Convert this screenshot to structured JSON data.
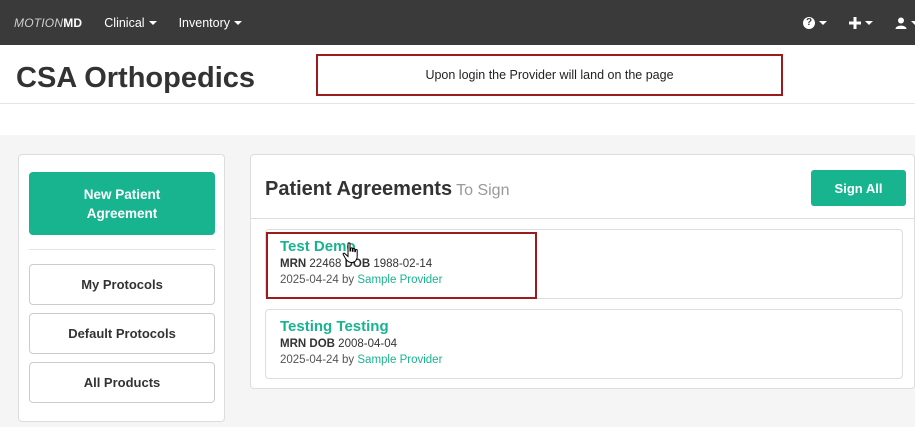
{
  "navbar": {
    "brand_part1": "MOTION",
    "brand_part2": "MD",
    "menus": [
      {
        "label": "Clinical"
      },
      {
        "label": "Inventory"
      }
    ],
    "icons": [
      "help-icon",
      "plus-icon",
      "user-icon"
    ],
    "background": "#3a3a3a"
  },
  "header": {
    "title": "CSA Orthopedics",
    "callout": "Upon login the Provider will land on the page"
  },
  "sidebar": {
    "new_button": "New Patient Agreement",
    "items": [
      {
        "label": "My Protocols"
      },
      {
        "label": "Default Protocols"
      },
      {
        "label": "All Products"
      }
    ]
  },
  "panel": {
    "title": "Patient Agreements",
    "subtitle": "To Sign",
    "sign_all": "Sign All",
    "agreements": [
      {
        "name": "Test Demo",
        "mrn_label": "MRN",
        "mrn": "22468",
        "dob_label": "DOB",
        "dob": "1988-02-14",
        "date": "2025-04-24",
        "by": "by",
        "provider": "Sample Provider"
      },
      {
        "name": "Testing Testing",
        "mrn_label": "MRN",
        "mrn": "",
        "dob_label": "DOB",
        "dob": "2008-04-04",
        "date": "2025-04-24",
        "by": "by",
        "provider": "Sample Provider"
      }
    ]
  },
  "colors": {
    "accent": "#18b48f",
    "annotation": "#9b1c1c"
  }
}
